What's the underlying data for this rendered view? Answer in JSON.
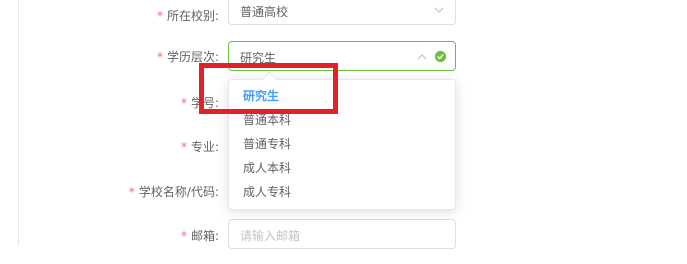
{
  "form": {
    "campus_type": {
      "label": "所在校别:",
      "value": "普通高校"
    },
    "education_level": {
      "label": "学历层次:",
      "value": "研究生"
    },
    "student_no": {
      "label": "学号:"
    },
    "major": {
      "label": "专业:"
    },
    "school_name_code": {
      "label": "学校名称/代码:"
    },
    "email": {
      "label": "邮箱:",
      "placeholder": "请输入邮箱"
    }
  },
  "required_mark": "*",
  "dropdown": {
    "options": [
      "研究生",
      "普通本科",
      "普通专科",
      "成人本科",
      "成人专科"
    ],
    "selected": "研究生"
  },
  "icons": {
    "campus_chevron": "chevron-down-icon",
    "level_chevron": "chevron-up-icon",
    "valid": "check-circle-icon"
  },
  "colors": {
    "required": "#f56c6c",
    "valid_border": "#67c23a",
    "selected_option": "#409eff",
    "highlight_box": "#e3202a"
  }
}
